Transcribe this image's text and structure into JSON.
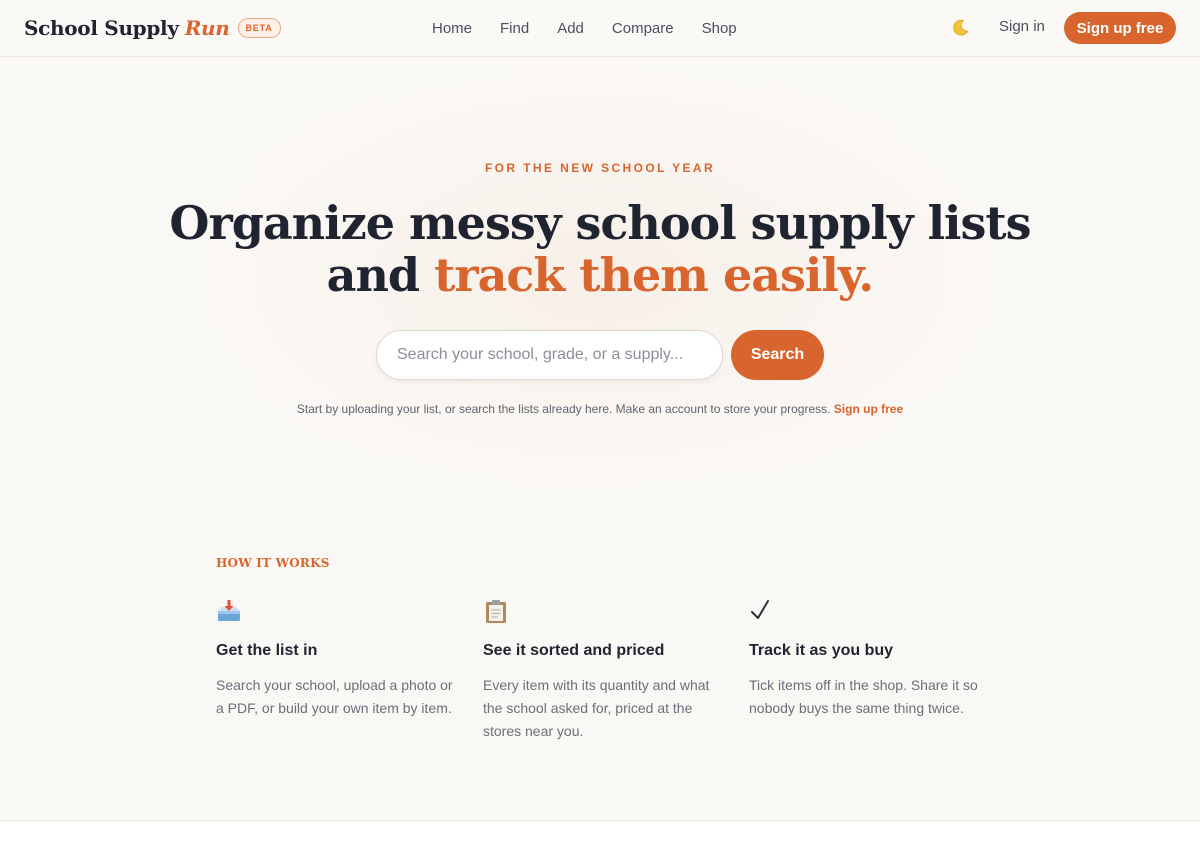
{
  "brand": {
    "name": "School Supply",
    "accent": "Run",
    "badge": "BETA"
  },
  "nav": {
    "items": [
      {
        "label": "Home"
      },
      {
        "label": "Find"
      },
      {
        "label": "Add"
      },
      {
        "label": "Compare"
      },
      {
        "label": "Shop"
      }
    ],
    "theme_icon": "moon-icon",
    "signin_label": "Sign in",
    "signup_label": "Sign up free"
  },
  "hero": {
    "eyebrow": "FOR THE NEW SCHOOL YEAR",
    "headline_main": "Organize messy school supply lists and ",
    "headline_accent": "track them easily.",
    "search_placeholder": "Search your school, grade, or a supply...",
    "search_value": "",
    "search_button": "Search",
    "hint_text": "Start by uploading your list, or search the lists already here. Make an account to store your progress. ",
    "hint_link": "Sign up free"
  },
  "how_it_works": {
    "label": "HOW IT WORKS",
    "steps": [
      {
        "icon": "inbox-tray-icon",
        "title": "Get the list in",
        "body": "Search your school, upload a photo or a PDF, or build your own item by item."
      },
      {
        "icon": "clipboard-icon",
        "title": "See it sorted and priced",
        "body": "Every item with its quantity and what the school asked for, priced at the stores near you."
      },
      {
        "icon": "checkmark-icon",
        "title": "Track it as you buy",
        "body": "Tick items off in the shop. Share it so nobody buys the same thing twice."
      }
    ]
  },
  "colors": {
    "accent": "#d9652e",
    "text": "#1f2430",
    "muted": "#6b6f7a",
    "background": "#faf8f5"
  }
}
